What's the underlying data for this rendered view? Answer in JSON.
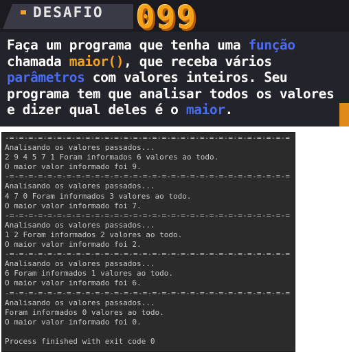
{
  "banner": {
    "badge_label": "DESAFIO",
    "number": "099",
    "text_parts": [
      {
        "text": "Faça um programa que tenha uma ",
        "style": "white"
      },
      {
        "text": "função",
        "style": "blue"
      },
      {
        "text": " chamada ",
        "style": "white"
      },
      {
        "text": "maior()",
        "style": "orange"
      },
      {
        "text": ", que receba vários ",
        "style": "white"
      },
      {
        "text": "parâmetros",
        "style": "blue"
      },
      {
        "text": " com valores inteiros. Seu programa tem que analisar todos os valores e dizer qual deles é o ",
        "style": "white"
      },
      {
        "text": "maior",
        "style": "blue"
      },
      {
        "text": ".",
        "style": "white"
      }
    ],
    "colors": {
      "accent_orange": "#f7a21b",
      "accent_blue": "#4b6cf0",
      "background": "#23232b"
    }
  },
  "console": {
    "separator": "-=-=-=-=-=-=-=-=-=-=-=-=-=-=-=-=-=-=-=-=-=-=-=-=-=-=-=-=-=-=",
    "blocks": [
      {
        "header": "Analisando os valores passados...",
        "values": "2 9 4 5 7 1 Foram informados 6 valores ao todo.",
        "result": "O maior valor informado foi 9."
      },
      {
        "header": "Analisando os valores passados...",
        "values": "4 7 0 Foram informados 3 valores ao todo.",
        "result": "O maior valor informado foi 7."
      },
      {
        "header": "Analisando os valores passados...",
        "values": "1 2 Foram informados 2 valores ao todo.",
        "result": "O maior valor informado foi 2."
      },
      {
        "header": "Analisando os valores passados...",
        "values": "6 Foram informados 1 valores ao todo.",
        "result": "O maior valor informado foi 6."
      },
      {
        "header": "Analisando os valores passados...",
        "values": "Foram informados 0 valores ao todo.",
        "result": "O maior valor informado foi 0."
      }
    ],
    "exit_message": "Process finished with exit code 0"
  }
}
